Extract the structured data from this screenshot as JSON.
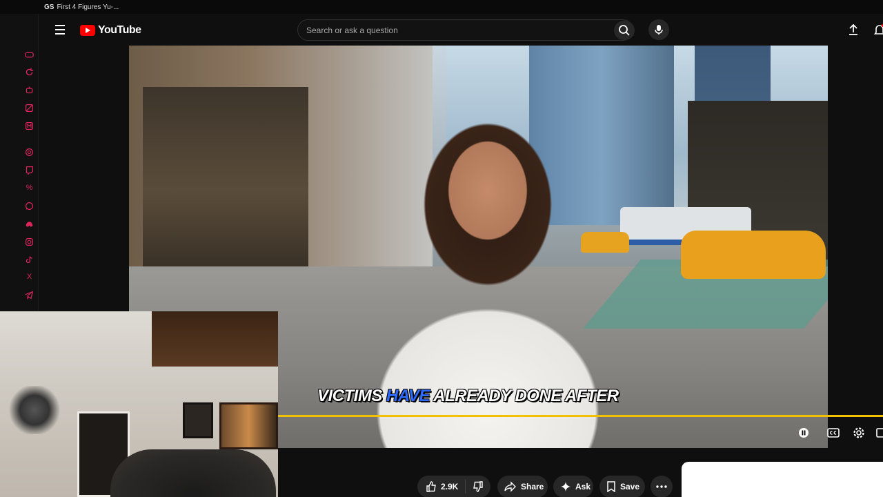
{
  "os_window": {
    "logo": "GS",
    "title": "First 4 Figures Yu-..."
  },
  "dock": {
    "icons": [
      "gamepad-icon",
      "refresh-icon",
      "robot-icon",
      "mask-icon",
      "m-badge-icon",
      "openai-icon",
      "twitch-icon",
      "percent-icon",
      "whatsapp-icon",
      "discord-icon",
      "instagram-icon",
      "tiktok-icon",
      "x-icon",
      "telegram-icon"
    ],
    "percent_glyph": "%",
    "x_glyph": "X"
  },
  "header": {
    "logo_text": "YouTube",
    "search_placeholder": "Search or ask a question"
  },
  "video": {
    "subtitle_word1": "VICTIMS",
    "subtitle_highlight": "HAVE",
    "subtitle_rest": "ALREADY DONE AFTER",
    "progress_fraction": 1.0,
    "accent_color": "#f2c200",
    "highlight_color": "#2d6bff"
  },
  "actions": {
    "like_count": "2.9K",
    "share_label": "Share",
    "ask_label": "Ask",
    "save_label": "Save"
  },
  "colors": {
    "background": "#0f0f0f",
    "brand_red": "#ff0000",
    "dock_accent": "#e0245e"
  }
}
